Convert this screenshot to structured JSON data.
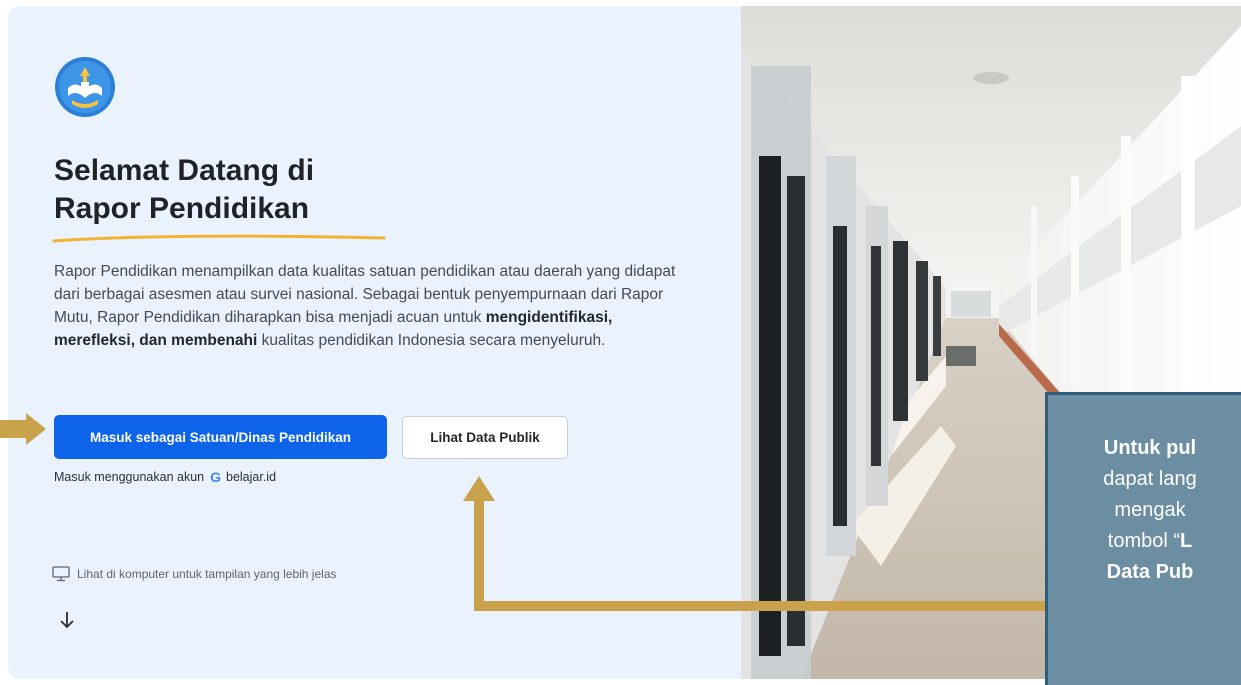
{
  "welcome": {
    "title_line1": "Selamat Datang di",
    "title_line2": "Rapor Pendidikan"
  },
  "intro": {
    "p1": "Rapor Pendidikan menampilkan data kualitas satuan pendidikan atau daerah yang didapat dari berbagai asesmen atau survei nasional. Sebagai bentuk penyempurnaan dari Rapor Mutu, Rapor Pendidikan diharapkan bisa menjadi acuan untuk ",
    "bold": "mengidentifikasi, merefleksi, dan membenahi",
    "p2": " kualitas pendidikan Indonesia secara menyeluruh."
  },
  "buttons": {
    "login_label": "Masuk sebagai Satuan/Dinas Pendidikan",
    "public_label": "Lihat Data Publik"
  },
  "login_hint": {
    "prefix": "Masuk menggunakan akun",
    "provider": "belajar.id"
  },
  "desktop_note": "Lihat di komputer untuk tampilan yang lebih jelas",
  "callout": {
    "line1": "Untuk pul",
    "line2": "dapat lang",
    "line3": "mengak",
    "line4_prefix": "tombol “",
    "line4_bold": "L",
    "line5": "Data Pub"
  },
  "colors": {
    "primary": "#0d63e9",
    "panel_bg": "#eaf3fd",
    "annotation_arrow": "#c9a24b",
    "callout_bg": "#6b8ea3"
  }
}
